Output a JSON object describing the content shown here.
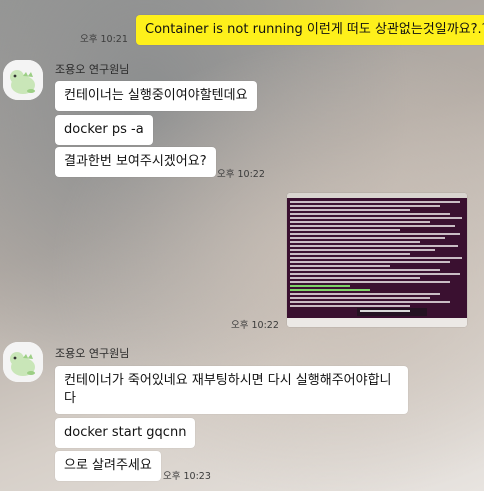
{
  "messages": {
    "m1_text": "Container is not running 이런게 떠도 상관없는것일까요?.?",
    "m1_time": "오후 10:21",
    "sender1": "조용오 연구원님",
    "m2_text": "컨테이너는 실행중이여야할텐데요",
    "m3_text": "docker ps -a",
    "m4_text": "결과한번 보여주시겠어요?",
    "m4_time": "오후 10:22",
    "m5_time": "오후 10:22",
    "sender2": "조용오 연구원님",
    "m6_text": "컨테이너가 죽어있네요 재부팅하시면 다시 실행해주어야합니다",
    "m7_text": "docker start gqcnn",
    "m8_text": "으로 살려주세요",
    "m8_time": "오후 10:23"
  },
  "colors": {
    "my_bubble": "#fef01b",
    "other_bubble": "#ffffff",
    "terminal_bg": "#3a1030"
  },
  "icons": {
    "avatar": "dinosaur-avatar-icon"
  }
}
